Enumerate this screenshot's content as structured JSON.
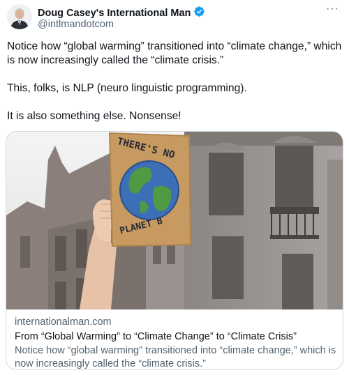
{
  "author": {
    "display_name": "Doug Casey's International Man",
    "handle": "@intlmandotcom",
    "verified_icon": "verified-badge-icon",
    "more_label": "···"
  },
  "tweet": {
    "paragraphs": [
      "Notice how “global warming” transitioned into “climate change,” which is now increasingly called the “climate crisis.”",
      "This, folks, is NLP (neuro linguistic programming).",
      "It is also something else. Nonsense!"
    ]
  },
  "card": {
    "sign_text_top": "THERE'S NO",
    "sign_text_bottom": "PLANET B",
    "domain": "internationalman.com",
    "title": "From “Global Warming” to “Climate Change” to “Climate Crisis”",
    "description": "Notice how “global warming” transitioned into “climate change,” which is now increasingly called the “climate crisis.”"
  },
  "colors": {
    "accent_verified": "#1d9bf0",
    "text_primary": "#0f1419",
    "text_secondary": "#536471",
    "card_border": "#cfd9de"
  }
}
